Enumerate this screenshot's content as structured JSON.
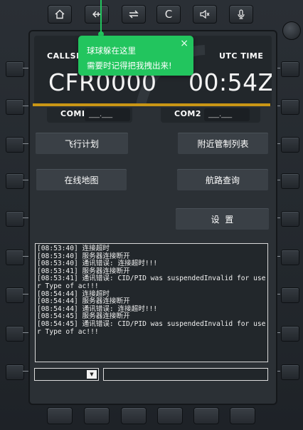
{
  "top_buttons": [
    {
      "name": "home-icon"
    },
    {
      "name": "back-icon"
    },
    {
      "name": "swap-icon"
    },
    {
      "name": "clear-button",
      "label": "C"
    },
    {
      "name": "volume-icon"
    },
    {
      "name": "microphone-icon"
    }
  ],
  "header": {
    "callsign_label": "CALLSIGN",
    "callsign_value": "CFR0000",
    "utc_label": "UTC TIME",
    "utc_value": "00:54Z"
  },
  "com": {
    "com1_label": "COMI",
    "com1_value": "___.___",
    "com2_label": "COM2",
    "com2_value": "___.___"
  },
  "menu": {
    "flight_plan": "飞行计划",
    "nearby_atc": "附近管制列表",
    "online_map": "在线地图",
    "route_query": "航路查询",
    "settings": "设  置"
  },
  "tooltip": {
    "line1": "球球躲在这里",
    "line2": "需要时记得把我拽出来!",
    "close": "×"
  },
  "log": [
    "[08:53:40] 连接超时",
    "[08:53:40] 服务器连接断开",
    "[08:53:40] 通讯错误: 连接超时!!!",
    "[08:53:41] 服务器连接断开",
    "[08:53:41] 通讯错误: CID/PID was suspendedInvalid for user Type of ac!!!",
    "[08:54:44] 连接超时",
    "[08:54:44] 服务器连接断开",
    "[08:54:44] 通讯错误: 连接超时!!!",
    "[08:54:45] 服务器连接断开",
    "[08:54:45] 通讯错误: CID/PID was suspendedInvalid for user Type of ac!!!"
  ],
  "select": {
    "value": "",
    "arrow": "▼"
  },
  "input": {
    "value": ""
  },
  "colors": {
    "accent_green": "#22c55e",
    "gold_bar": "#c99615",
    "screen_bg": "#2b3035"
  }
}
